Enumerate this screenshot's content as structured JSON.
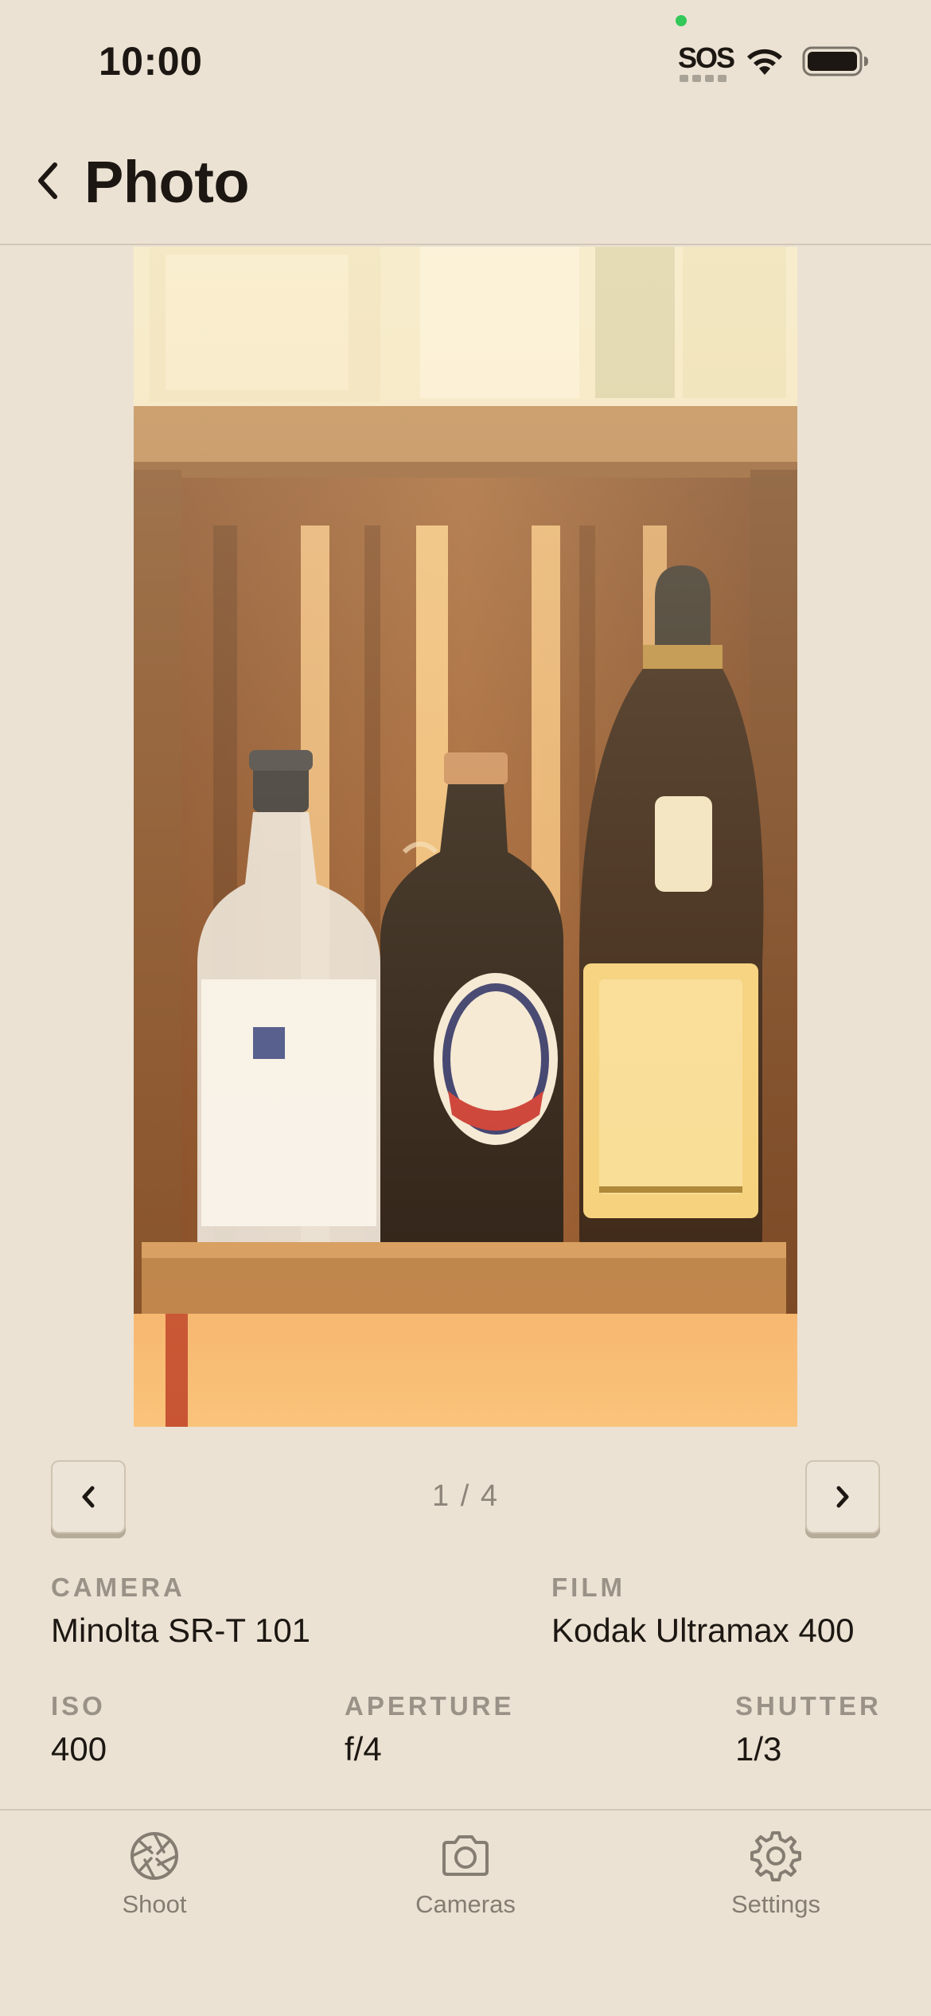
{
  "status_bar": {
    "time": "10:00",
    "carrier": "SOS",
    "wifi_icon": "wifi-icon",
    "battery_icon": "battery-icon"
  },
  "header": {
    "back_icon": "chevron-left-icon",
    "title": "Photo"
  },
  "photo": {
    "description_icon": "photo-image"
  },
  "pager": {
    "prev_icon": "chevron-left-icon",
    "next_icon": "chevron-right-icon",
    "count": "1 / 4"
  },
  "details": {
    "camera_label": "CAMERA",
    "camera_value": "Minolta SR-T 101",
    "film_label": "FILM",
    "film_value": "Kodak Ultramax 400",
    "iso_label": "ISO",
    "iso_value": "400",
    "aperture_label": "APERTURE",
    "aperture_value": "f/4",
    "shutter_label": "SHUTTER",
    "shutter_value": "1/3"
  },
  "tabs": [
    {
      "label": "Shoot",
      "icon": "aperture-icon"
    },
    {
      "label": "Cameras",
      "icon": "camera-icon"
    },
    {
      "label": "Settings",
      "icon": "gear-icon"
    }
  ],
  "colors": {
    "background": "#ebe2d3",
    "text": "#1c1712",
    "muted": "#9a9287",
    "status_dot": "#34c759"
  }
}
